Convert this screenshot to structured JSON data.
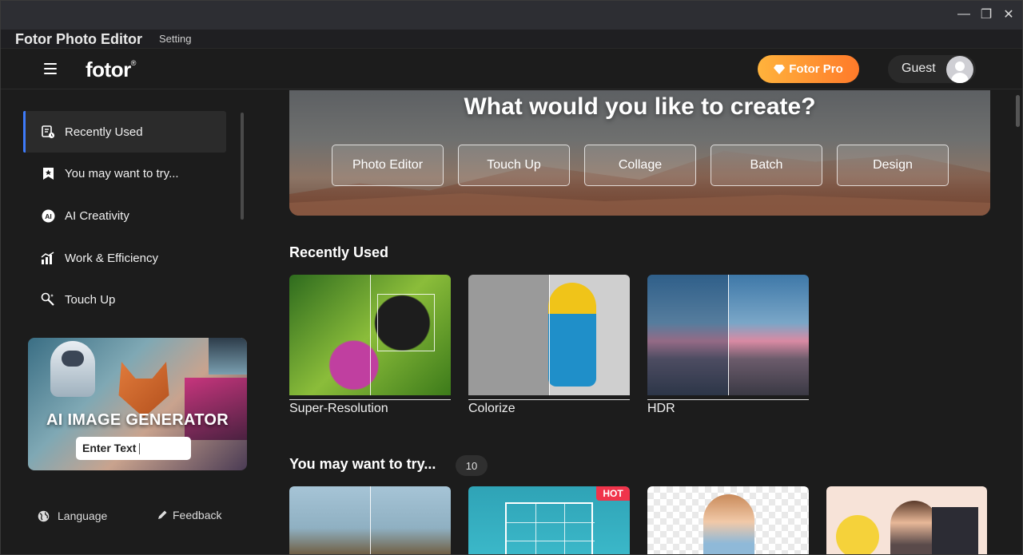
{
  "window": {
    "controls": {
      "minimize": "—",
      "restore": "❐",
      "close": "✕"
    }
  },
  "menubar": {
    "app_name": "Fotor Photo Editor",
    "setting": "Setting"
  },
  "header": {
    "logo": "fotor",
    "logo_mark": "®",
    "pro_label": "Fotor Pro",
    "guest_label": "Guest"
  },
  "sidebar": {
    "items": [
      {
        "label": "Recently Used",
        "icon": "recent-icon",
        "active": true
      },
      {
        "label": "You may want to try...",
        "icon": "bookmark-star-icon",
        "active": false
      },
      {
        "label": "AI Creativity",
        "icon": "ai-icon",
        "active": false
      },
      {
        "label": "Work & Efficiency",
        "icon": "chart-icon",
        "active": false
      },
      {
        "label": "Touch Up",
        "icon": "touch-up-icon",
        "active": false
      }
    ],
    "banner": {
      "title": "AI IMAGE GENERATOR",
      "input_text": "Enter Text"
    },
    "footer": {
      "language": "Language",
      "feedback": "Feedback"
    }
  },
  "hero": {
    "title": "What would you like to create?",
    "buttons": [
      "Photo Editor",
      "Touch Up",
      "Collage",
      "Batch",
      "Design"
    ]
  },
  "recently_used": {
    "title": "Recently Used",
    "items": [
      {
        "label": "Super-Resolution"
      },
      {
        "label": "Colorize"
      },
      {
        "label": "HDR"
      }
    ]
  },
  "you_may_try": {
    "title": "You may want to try...",
    "count": "10",
    "hot_badge": "HOT"
  },
  "colors": {
    "accent": "#3e7bfa",
    "pro_gradient_start": "#ffb33c",
    "pro_gradient_end": "#ff7a2a",
    "hot": "#f0344b"
  }
}
